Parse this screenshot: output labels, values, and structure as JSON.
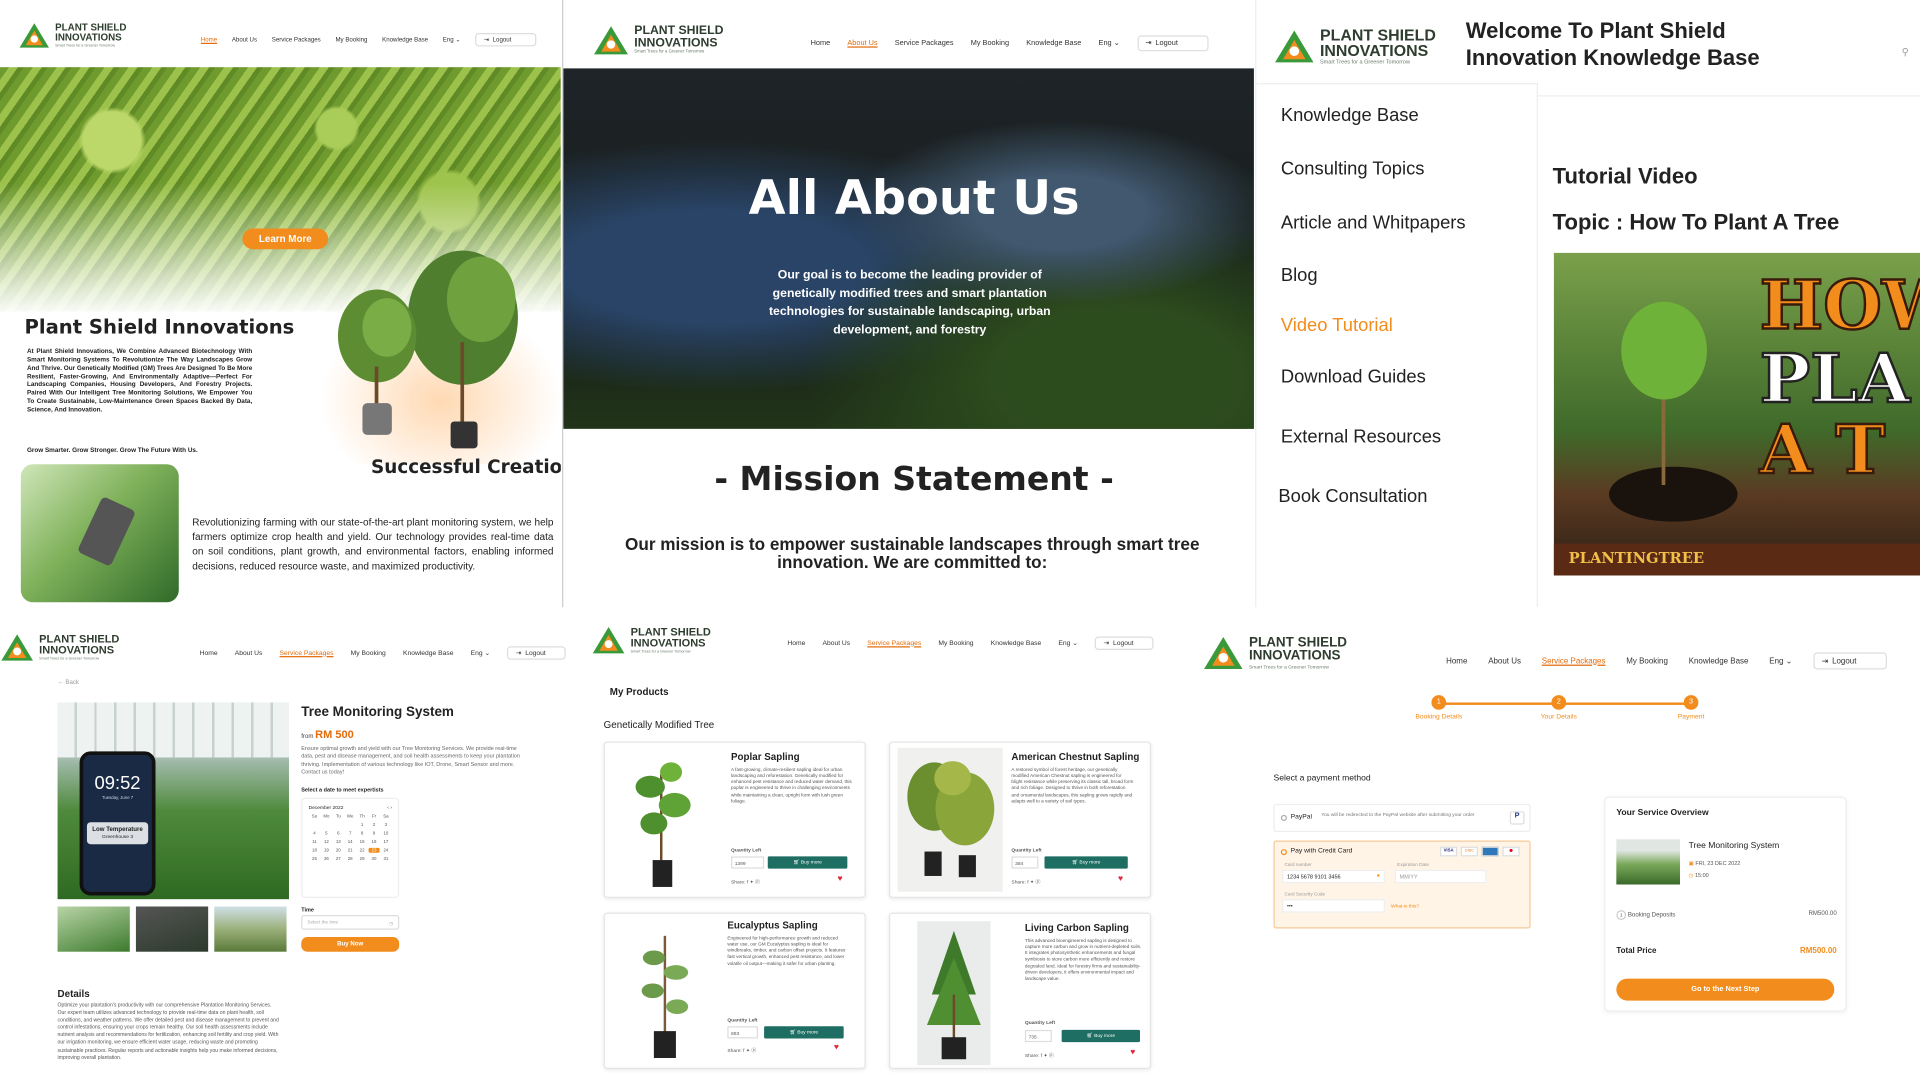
{
  "logo": {
    "line1": "PLANT SHIELD",
    "line2": "INNOVATIONS",
    "tagline": "Smart Trees for a Greener Tomorrow"
  },
  "colors": {
    "accent": "#e26b0a",
    "brand_green": "#1f6e63",
    "logo_green": "#3a9a3a"
  },
  "nav": {
    "home": "Home",
    "about": "About Us",
    "packages": "Service Packages",
    "booking": "My Booking",
    "kb": "Knowledge Base",
    "lang": "Eng",
    "logout": "Logout"
  },
  "home": {
    "learn_more": "Learn More",
    "title": "Plant Shield Innovations",
    "body": "At Plant Shield Innovations, We Combine Advanced Biotechnology With Smart Monitoring Systems To Revolutionize The Way Landscapes Grow And Thrive. Our Genetically Modified (GM) Trees Are Designed To Be More Resilient, Faster-Growing, And Environmentally Adaptive—Perfect For Landscaping Companies, Housing Developers, And Forestry Projects. Paired With Our Intelligent Tree Monitoring Solutions, We Empower You To Create Sustainable, Low-Maintenance Green Spaces Backed By Data, Science, And Innovation.",
    "slogan": "Grow Smarter. Grow Stronger. Grow The Future With Us.",
    "success": "Successful Creation",
    "success_text": "Revolutionizing farming with our state-of-the-art plant monitoring system, we help farmers optimize crop health and yield. Our technology provides real-time data on soil conditions, plant growth, and environmental factors, enabling informed decisions, reduced resource waste, and maximized productivity."
  },
  "about": {
    "hero": "All About Us",
    "goal": "Our goal is to  become the leading provider of genetically modified trees and smart plantation technologies for sustainable landscaping, urban development, and forestry",
    "mission_title": "- Mission Statement -",
    "mission": "Our mission is to empower sustainable landscapes through smart tree innovation. We are committed to:"
  },
  "kb": {
    "welcome": "Welcome To Plant Shield Innovation Knowledge Base",
    "items": [
      "Knowledge Base",
      "Consulting Topics",
      "Article and Whitpapers",
      "Blog",
      "Video Tutorial",
      "Download Guides",
      "External Resources",
      "Book Consultation"
    ],
    "video_title": "Tutorial Video",
    "topic": "Topic : How To Plant A Tree",
    "thumb_text": [
      "HOW",
      "PLA",
      "A T"
    ],
    "channel": "PLANTINGTREE"
  },
  "product": {
    "back": "Back",
    "title": "Tree Monitoring System",
    "from": "from",
    "price": "RM 500",
    "desc": "Ensure optimal growth and yield with our Tree Monitoring Services. We provide real-time data, pest and disease management, and soil health assessments to keep your plantation thriving. Implementation of various technology like IOT, Drone, Smart Sensor and more. Contact us today!",
    "select_date": "Select a date to meet expertists",
    "month": "December 2022",
    "weekdays": [
      "Su",
      "Mo",
      "Tu",
      "We",
      "Th",
      "Fr",
      "Sa"
    ],
    "days": [
      "",
      "",
      "",
      "",
      "1",
      "2",
      "3",
      "4",
      "5",
      "6",
      "7",
      "8",
      "9",
      "10",
      "11",
      "12",
      "13",
      "14",
      "15",
      "16",
      "17",
      "18",
      "19",
      "20",
      "21",
      "22",
      "23",
      "24",
      "25",
      "26",
      "27",
      "28",
      "29",
      "30",
      "31"
    ],
    "selected_day": "23",
    "time_label": "Time",
    "time_placeholder": "Select the time",
    "buy_now": "Buy Now",
    "phone_time": "09:52",
    "phone_date": "Tuesday, June 7",
    "alert_title": "Low Temperature",
    "alert_sub": "Greenhouse 3",
    "details_title": "Details",
    "details": "Optimize your plantation's productivity with our comprehensive Plantation Monitoring Services. Our expert team utilizes advanced technology to provide real-time data on plant health, soil conditions, and weather patterns. We offer detailed pest and disease management to prevent and control infestations, ensuring your crops remain healthy. Our soil health assessments include nutrient analysis and recommendations for fertilization, enhancing soil fertility and crop yield. With our irrigation monitoring, we ensure efficient water usage, reducing waste and promoting sustainable practices. Regular reports and actionable insights help you make informed decisions, improving overall plantation."
  },
  "products": {
    "heading": "My Products",
    "category": "Genetically Modified Tree",
    "qty_label": "Quantity Left",
    "buy": "Buy more",
    "share": "Share:",
    "items": [
      {
        "name": "Poplar Sapling",
        "qty": "1399",
        "desc": "A fast-growing, climate-resilient sapling ideal for urban landscaping and reforestation. Genetically modified for enhanced pest resistance and reduced water demand, this poplar is engineered to thrive in challenging environments while maintaining a clean, upright form with lush green foliage."
      },
      {
        "name": "American Chestnut Sapling",
        "qty": "384",
        "desc": "A restored symbol of forest heritage, our genetically modified American Chestnut sapling is engineered for blight resistance while preserving its classic tall, broad form and rich foliage. Designed to thrive in both reforestation and ornamental landscapes, this sapling grows rapidly and adapts well to a variety of soil types."
      },
      {
        "name": "Eucalyptus Sapling",
        "qty": "893",
        "desc": "Engineered for high-performance growth and reduced water use, our GM Eucalyptus sapling is ideal for windbreaks, timber, and carbon offset projects. It features fast vertical growth, enhanced pest resistance, and lower volatile oil output—making it safer for urban planting."
      },
      {
        "name": "Living Carbon Sapling",
        "qty": "735",
        "desc": "This advanced bioengineered sapling is designed to capture more carbon and grow in nutrient-depleted soils. It integrates photosynthetic enhancements and fungal symbiosis to store carbon more efficiently and restore degraded land. Ideal for forestry firms and sustainability-driven developers, it offers environmental impact and landscape value."
      }
    ]
  },
  "payment": {
    "steps": [
      {
        "n": "1",
        "label": "Booking Details"
      },
      {
        "n": "2",
        "label": "Your Details"
      },
      {
        "n": "3",
        "label": "Payment"
      }
    ],
    "select_method": "Select a payment method",
    "paypal": "PayPal",
    "paypal_note": "You will be redirected to the PayPal website after submitting your order",
    "card": "Pay with Credit Card",
    "card_number_label": "Card number",
    "card_number": "1234 5678 9101 3456",
    "expiry_label": "Expiration Date",
    "expiry": "MM/YY",
    "cvc_label": "Card Security Code",
    "cvc": "•••",
    "what": "What is this?",
    "overview": "Your Service Overview",
    "service": "Tree Monitoring System",
    "date": "FRI, 23 DEC 2022",
    "time": "15:00",
    "deposit_label": "Booking Deposits",
    "deposit": "RM500.00",
    "total_label": "Total Price",
    "total": "RM500.00",
    "next": "Go to the Next Step"
  }
}
